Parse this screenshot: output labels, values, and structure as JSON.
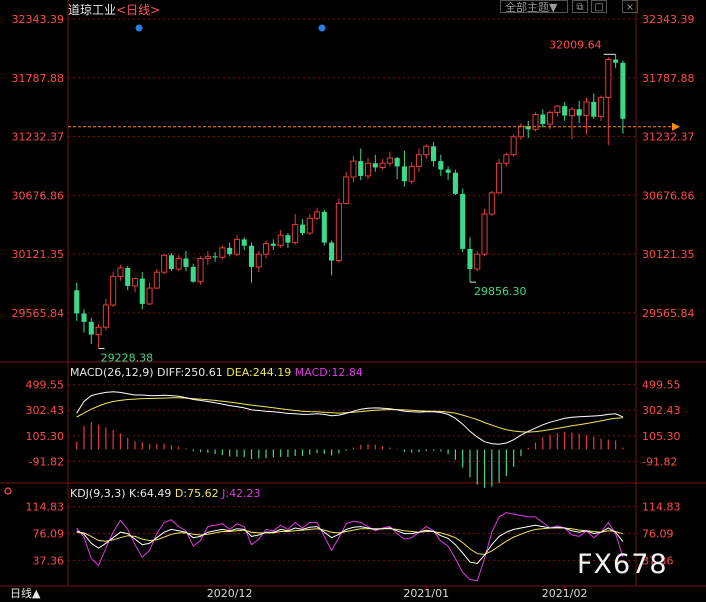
{
  "header": {
    "symbol": "道琼工业",
    "timeframe": "<日线>",
    "theme_button": "全部主题▼"
  },
  "controls": {
    "close_glyph": "×",
    "restore_glyph": "⧉",
    "maximize_glyph": "□"
  },
  "colors": {
    "up": "#e23b3b",
    "down": "#3cd98a",
    "grid": "#7a1010",
    "axis_text": "#ff4a4a",
    "price_line": "#ff8c1a",
    "macd_line": "#ffffff",
    "dea_line": "#f0e65a",
    "k_line": "#ffffff",
    "d_line": "#f0e65a",
    "j_line": "#e03be0"
  },
  "chart_data": [
    {
      "type": "candlestick",
      "panel": "price",
      "y_ticks": [
        "32343.39",
        "31787.88",
        "31232.37",
        "30676.86",
        "30121.35",
        "29565.84"
      ],
      "ylim": [
        29120,
        32343.39
      ],
      "x_labels": [
        "2020/12",
        "2021/01",
        "2021/02"
      ],
      "annotations": {
        "high": "32009.64",
        "low": "29228.38",
        "mid_low": "29856.30"
      },
      "current_price": 31325,
      "ohlc": [
        [
          29780,
          29850,
          29490,
          29560
        ],
        [
          29560,
          29600,
          29380,
          29480
        ],
        [
          29480,
          29520,
          29270,
          29360
        ],
        [
          29360,
          29460,
          29228,
          29430
        ],
        [
          29430,
          29700,
          29400,
          29640
        ],
        [
          29640,
          29950,
          29620,
          29910
        ],
        [
          29910,
          30020,
          29870,
          29990
        ],
        [
          29990,
          30010,
          29780,
          29820
        ],
        [
          29820,
          29900,
          29760,
          29890
        ],
        [
          29890,
          29950,
          29600,
          29650
        ],
        [
          29650,
          29850,
          29640,
          29800
        ],
        [
          29800,
          29980,
          29790,
          29950
        ],
        [
          29950,
          30120,
          29930,
          30110
        ],
        [
          30110,
          30130,
          29960,
          29980
        ],
        [
          29980,
          30110,
          29960,
          30080
        ],
        [
          30080,
          30150,
          29960,
          30000
        ],
        [
          30000,
          30030,
          29850,
          29860
        ],
        [
          29860,
          30100,
          29830,
          30080
        ],
        [
          30080,
          30150,
          30020,
          30100
        ],
        [
          30100,
          30140,
          30050,
          30090
        ],
        [
          30090,
          30200,
          30070,
          30180
        ],
        [
          30180,
          30230,
          30100,
          30120
        ],
        [
          30120,
          30300,
          30100,
          30260
        ],
        [
          30260,
          30280,
          30160,
          30200
        ],
        [
          30200,
          30230,
          29850,
          30000
        ],
        [
          30000,
          30150,
          29950,
          30120
        ],
        [
          30120,
          30250,
          30080,
          30220
        ],
        [
          30220,
          30260,
          30160,
          30200
        ],
        [
          30200,
          30350,
          30180,
          30300
        ],
        [
          30300,
          30320,
          30180,
          30230
        ],
        [
          30230,
          30500,
          30210,
          30400
        ],
        [
          30400,
          30450,
          30300,
          30320
        ],
        [
          30320,
          30500,
          30300,
          30460
        ],
        [
          30460,
          30560,
          30440,
          30520
        ],
        [
          30520,
          30540,
          30200,
          30230
        ],
        [
          30230,
          30250,
          29920,
          30060
        ],
        [
          30060,
          30650,
          30040,
          30600
        ],
        [
          30600,
          30900,
          30590,
          30850
        ],
        [
          30850,
          31050,
          30800,
          31000
        ],
        [
          31000,
          31120,
          30820,
          30860
        ],
        [
          30860,
          31030,
          30830,
          30980
        ],
        [
          30980,
          31060,
          30900,
          30940
        ],
        [
          30940,
          31020,
          30920,
          30980
        ],
        [
          30980,
          31090,
          30950,
          31030
        ],
        [
          31030,
          31040,
          30830,
          30950
        ],
        [
          30950,
          31100,
          30760,
          30810
        ],
        [
          30810,
          30990,
          30780,
          30950
        ],
        [
          30950,
          31120,
          30900,
          31060
        ],
        [
          31060,
          31160,
          31020,
          31140
        ],
        [
          31140,
          31180,
          30950,
          31000
        ],
        [
          31000,
          31060,
          30860,
          30920
        ],
        [
          30920,
          30950,
          30820,
          30890
        ],
        [
          30890,
          30920,
          30680,
          30690
        ],
        [
          30690,
          30740,
          30140,
          30170
        ],
        [
          30170,
          30280,
          29856,
          29980
        ],
        [
          29980,
          30150,
          29960,
          30120
        ],
        [
          30120,
          30550,
          30100,
          30500
        ],
        [
          30500,
          30720,
          30480,
          30700
        ],
        [
          30700,
          31020,
          30690,
          30980
        ],
        [
          30980,
          31080,
          30950,
          31060
        ],
        [
          31060,
          31250,
          31040,
          31230
        ],
        [
          31230,
          31360,
          31200,
          31330
        ],
        [
          31330,
          31380,
          31220,
          31300
        ],
        [
          31300,
          31460,
          31280,
          31440
        ],
        [
          31440,
          31490,
          31320,
          31350
        ],
        [
          31350,
          31480,
          31300,
          31460
        ],
        [
          31460,
          31530,
          31420,
          31520
        ],
        [
          31520,
          31560,
          31380,
          31430
        ],
        [
          31430,
          31510,
          31210,
          31490
        ],
        [
          31490,
          31570,
          31360,
          31430
        ],
        [
          31430,
          31600,
          31250,
          31560
        ],
        [
          31560,
          31640,
          31400,
          31420
        ],
        [
          31420,
          31620,
          31380,
          31600
        ],
        [
          31600,
          31980,
          31150,
          31960
        ],
        [
          31960,
          32009.64,
          31880,
          31930
        ],
        [
          31930,
          31950,
          31260,
          31400
        ]
      ]
    },
    {
      "type": "macd",
      "panel": "macd",
      "params": "MACD(26,12,9)",
      "diff_label": "DIFF:",
      "diff_value": "250.61",
      "dea_label": "DEA:",
      "dea_value": "244.19",
      "macd_label": "MACD:",
      "macd_value": "12.84",
      "y_ticks": [
        "499.55",
        "302.43",
        "105.30",
        "-91.82"
      ],
      "ylim": [
        -220,
        520
      ],
      "diff": [
        280,
        370,
        415,
        430,
        440,
        445,
        440,
        430,
        420,
        420,
        415,
        415,
        418,
        415,
        410,
        400,
        385,
        378,
        370,
        360,
        350,
        338,
        330,
        320,
        305,
        300,
        295,
        290,
        285,
        278,
        275,
        270,
        272,
        276,
        270,
        260,
        265,
        278,
        295,
        310,
        318,
        320,
        318,
        314,
        305,
        295,
        290,
        288,
        290,
        290,
        285,
        270,
        240,
        195,
        140,
        95,
        60,
        45,
        40,
        50,
        75,
        110,
        140,
        165,
        190,
        210,
        225,
        240,
        248,
        252,
        255,
        258,
        262,
        270,
        275,
        251
      ],
      "dea": [
        250,
        280,
        310,
        335,
        355,
        370,
        378,
        385,
        388,
        392,
        393,
        394,
        396,
        398,
        398,
        396,
        392,
        388,
        383,
        378,
        372,
        365,
        358,
        350,
        342,
        335,
        328,
        321,
        314,
        307,
        300,
        295,
        292,
        290,
        287,
        283,
        280,
        283,
        287,
        292,
        297,
        302,
        305,
        307,
        307,
        305,
        302,
        298,
        296,
        295,
        293,
        288,
        280,
        265,
        248,
        230,
        208,
        188,
        168,
        152,
        142,
        136,
        134,
        138,
        144,
        153,
        162,
        172,
        182,
        191,
        200,
        210,
        220,
        232,
        240,
        244
      ]
    },
    {
      "type": "kdj",
      "panel": "kdj",
      "params": "KDJ(9,3,3)",
      "k_label": "K:",
      "k_value": "64.49",
      "d_label": "D:",
      "d_value": "75.62",
      "j_label": "J:",
      "j_value": "42.23",
      "y_ticks": [
        "114.83",
        "76.09",
        "37.36"
      ],
      "ylim": [
        2,
        120
      ],
      "k": [
        80,
        75,
        62,
        55,
        62,
        70,
        78,
        76,
        68,
        60,
        62,
        70,
        78,
        82,
        80,
        78,
        70,
        72,
        78,
        80,
        82,
        80,
        83,
        82,
        72,
        74,
        78,
        78,
        82,
        80,
        84,
        82,
        85,
        86,
        78,
        70,
        75,
        82,
        85,
        86,
        84,
        82,
        83,
        84,
        80,
        76,
        76,
        78,
        81,
        79,
        73,
        69,
        60,
        48,
        35,
        33,
        45,
        60,
        72,
        78,
        82,
        84,
        86,
        88,
        86,
        84,
        85,
        84,
        80,
        78,
        80,
        76,
        78,
        84,
        78,
        64.49
      ],
      "d": [
        78,
        77,
        72,
        66,
        65,
        67,
        70,
        73,
        72,
        68,
        66,
        67,
        71,
        75,
        77,
        77,
        75,
        74,
        75,
        77,
        79,
        79,
        80,
        81,
        78,
        77,
        77,
        77,
        79,
        79,
        80,
        81,
        82,
        83,
        81,
        78,
        77,
        79,
        81,
        83,
        83,
        83,
        83,
        83,
        82,
        80,
        79,
        78,
        79,
        79,
        77,
        74,
        70,
        63,
        54,
        47,
        46,
        51,
        58,
        65,
        71,
        75,
        79,
        82,
        83,
        84,
        84,
        84,
        83,
        81,
        80,
        79,
        78,
        80,
        79,
        75.62
      ],
      "j": [
        84,
        71,
        40,
        30,
        55,
        78,
        95,
        82,
        60,
        42,
        52,
        76,
        92,
        96,
        86,
        80,
        58,
        66,
        86,
        88,
        90,
        82,
        90,
        86,
        60,
        68,
        82,
        80,
        88,
        82,
        92,
        84,
        92,
        92,
        72,
        52,
        70,
        90,
        94,
        92,
        86,
        80,
        84,
        86,
        76,
        68,
        70,
        78,
        86,
        80,
        65,
        58,
        40,
        20,
        10,
        8,
        40,
        78,
        100,
        106,
        104,
        102,
        100,
        100,
        92,
        84,
        87,
        84,
        74,
        72,
        80,
        70,
        78,
        92,
        76,
        42.23
      ]
    }
  ],
  "bottom": {
    "tab_label": "日线▲"
  },
  "watermark": "FX678"
}
